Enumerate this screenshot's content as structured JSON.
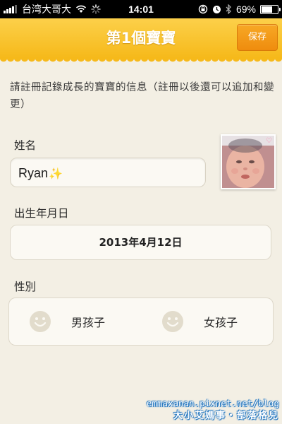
{
  "status_bar": {
    "carrier": "台湾大哥大",
    "time": "14:01",
    "battery": "69%",
    "battery_level": 0.69,
    "icons": [
      "signal-icon",
      "wifi-icon",
      "activity-spinner-icon",
      "rotation-lock-icon",
      "alarm-icon",
      "bluetooth-icon",
      "battery-icon"
    ]
  },
  "nav": {
    "title": "第1個寶寶",
    "save_label": "保存"
  },
  "intro_text": "請註冊記錄成長的寶寶的信息（註冊以後還可以追加和變更）",
  "name_section": {
    "label": "姓名",
    "value": "Ryan",
    "sparkle": "✨",
    "photo_decoration": "♡"
  },
  "birthday_section": {
    "label": "出生年月日",
    "value": "2013年4月12日"
  },
  "gender_section": {
    "label": "性別",
    "options": [
      {
        "label": "男孩子",
        "selected": false
      },
      {
        "label": "女孩子",
        "selected": false
      }
    ]
  },
  "watermark": {
    "line1": "emmaxanan.pixnet.net/blog",
    "line2": "大小艾媽事・部落格兒"
  },
  "colors": {
    "nav_yellow": "#f9c630",
    "save_orange": "#f39a19",
    "background": "#f3efe4",
    "field_bg": "#fbf9f3",
    "smiley": "#e2dccc"
  }
}
